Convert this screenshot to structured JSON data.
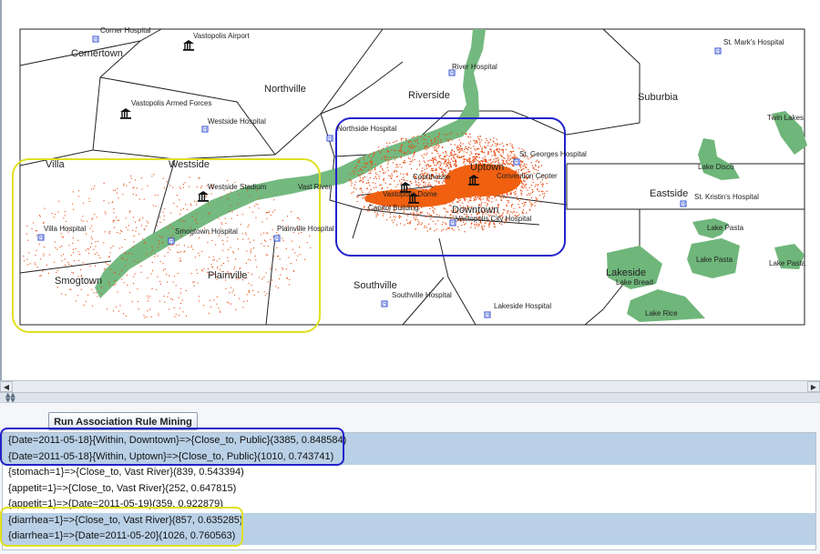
{
  "map": {
    "regions": [
      "Cornertown",
      "Northville",
      "Riverside",
      "Suburbia",
      "Villa",
      "Westside",
      "Smogtown",
      "Plainville",
      "Uptown",
      "Downtown",
      "Eastside",
      "Southville",
      "Lakeside"
    ],
    "places": {
      "corner_hospital": "Corner Hospital",
      "airport": "Vastopolis Airport",
      "st_marks": "St. Mark's Hospital",
      "river_hospital": "River Hospital",
      "armed_forces": "Vastopolis Armed Forces",
      "westside_hospital": "Westside Hospital",
      "northside_hospital": "Northside Hospital",
      "twin_lakes": "Twin Lakes",
      "st_georges": "St. Georges Hospital",
      "convention_center": "Convention Center",
      "lake_disco": "Lake Disco",
      "westside_stadium": "Westside Stadium",
      "vast_river": "Vast River",
      "courthouse": "Courthouse",
      "vastopolis_dome": "Vastopolis Dome",
      "capitol_building": "Capitol Building",
      "city_hospital": "Vastopolis City Hospital",
      "st_kristins": "St. Kristin's Hospital",
      "villa_hospital": "Villa Hospital",
      "smogtown_hospital": "Smogtown Hospital",
      "plainville_hospital": "Plainville Hospital",
      "lake_pasta_1": "Lake Pasta",
      "lake_pasta_2": "Lake Pasta",
      "lake_pasta_3": "Lake Pasta",
      "lake_bread": "Lake Bread",
      "southville_hospital": "Southville Hospital",
      "lakeside_hospital": "Lakeside Hospital",
      "lake_rice": "Lake Rice"
    },
    "colors": {
      "river": "#74b97f",
      "lakes": "#6fb67a",
      "borders": "#222222",
      "points": "#e84a10",
      "highlight_blue": "#2222cc",
      "highlight_yellow": "#e0e020",
      "hospital_icon": "#2a4ad0"
    }
  },
  "toolbar": {
    "run_button_label": "Run Association Rule Mining"
  },
  "rules": [
    {
      "text": "{Date=2011-05-18}{Within, Downtown}=>{Close_to, Public}(3385, 0.848584)",
      "selected": true
    },
    {
      "text": "{Date=2011-05-18}{Within, Uptown}=>{Close_to, Public}(1010, 0.743741)",
      "selected": true
    },
    {
      "text": "{stomach=1}=>{Close_to, Vast River}(839, 0.543394)",
      "selected": false
    },
    {
      "text": "{appetit=1}=>{Close_to, Vast River}(252, 0.647815)",
      "selected": false
    },
    {
      "text": "{appetit=1}=>{Date=2011-05-19}(359, 0.922879)",
      "selected": false
    },
    {
      "text": "{diarrhea=1}=>{Close_to, Vast River}(857, 0.635285)",
      "selected": true
    },
    {
      "text": "{diarrhea=1}=>{Date=2011-05-20}(1026, 0.760563)",
      "selected": true
    }
  ],
  "icons": {
    "hospital": "hospital-icon",
    "landmark": "landmark-icon",
    "scroll_left": "scroll-left-icon",
    "scroll_right": "scroll-right-icon",
    "splitter": "splitter-arrows-icon"
  }
}
